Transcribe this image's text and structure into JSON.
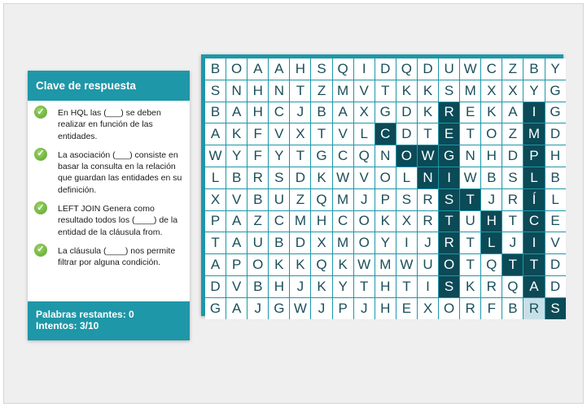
{
  "answer_key": {
    "title": "Clave de respuesta",
    "clues": [
      "En HQL las (___) se deben realizar en función de las entidades.",
      "La asociación (___) consiste en basar la consulta en la relación que guardan las entidades en su definición.",
      "LEFT JOIN Genera como resultado todos los (____) de la entidad de la cláusula from.",
      "La cláusula (____) nos permite filtrar por alguna condición."
    ],
    "remaining": "Palabras restantes: 0",
    "attempts": "Intentos: 3/10"
  },
  "colors": {
    "accent": "#1e97a8",
    "found": "#0b4a57",
    "pending": "#c8dfe8"
  },
  "icons": {
    "clue_status": "check-circle-icon"
  },
  "grid": {
    "rows": [
      "BOAAHSQIDQDUWCZBY",
      "SNHNTZMVTKKSMXXYG",
      "BAHCJBAXGDKREKAIG",
      "AKFVXTVLCDTETOZMD",
      "WYFYTGCQNOWGNHDPH",
      "LBRSDKWVOLNIWBSLB",
      "XVBUZQMJPSRSTJRÍL",
      "PAZCMHCOKXRTUHTCE",
      "TAUBDXMOYIJRTLJIV",
      "APOKKQKWMWUOTQTTD",
      "DVBHJKYTHTISKRQAD",
      "GAJGWJPJHEXORFBRS"
    ],
    "found_cells": [
      [
        2,
        11
      ],
      [
        3,
        11
      ],
      [
        4,
        11
      ],
      [
        5,
        11
      ],
      [
        6,
        11
      ],
      [
        7,
        11
      ],
      [
        8,
        11
      ],
      [
        9,
        11
      ],
      [
        10,
        11
      ],
      [
        3,
        8
      ],
      [
        4,
        9
      ],
      [
        4,
        10
      ],
      [
        5,
        10
      ],
      [
        6,
        12
      ],
      [
        7,
        13
      ],
      [
        8,
        13
      ],
      [
        9,
        14
      ],
      [
        2,
        15
      ],
      [
        3,
        15
      ],
      [
        4,
        15
      ],
      [
        5,
        15
      ],
      [
        6,
        15
      ],
      [
        7,
        15
      ],
      [
        8,
        15
      ],
      [
        9,
        15
      ],
      [
        10,
        15
      ],
      [
        11,
        16
      ]
    ],
    "pending_cells": [
      [
        11,
        15
      ]
    ]
  }
}
